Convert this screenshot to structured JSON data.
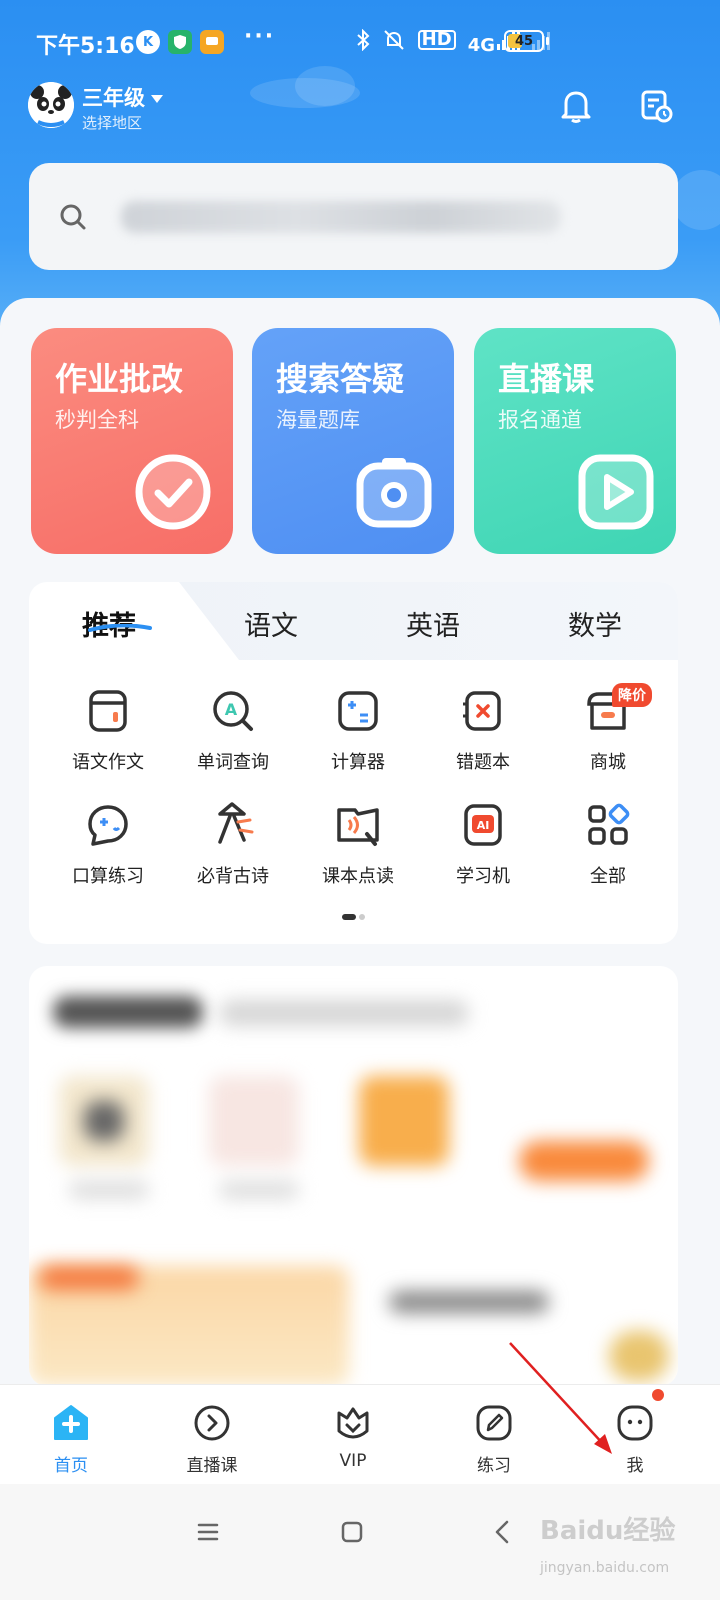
{
  "status_bar": {
    "time": "下午5:16",
    "app_icons": [
      "K",
      "shield",
      "message"
    ],
    "dots": "···",
    "hd": "HD",
    "network": "4G",
    "battery_level": "45"
  },
  "header": {
    "grade": "三年级",
    "region": "选择地区",
    "bell_icon": "bell-icon",
    "schedule_icon": "schedule-icon"
  },
  "search": {
    "icon": "search-icon"
  },
  "features": [
    {
      "title": "作业批改",
      "subtitle": "秒判全科",
      "color": "#fa7b73",
      "icon": "check-icon"
    },
    {
      "title": "搜索答疑",
      "subtitle": "海量题库",
      "color": "#5b97f5",
      "icon": "camera-icon"
    },
    {
      "title": "直播课",
      "subtitle": "报名通道",
      "color": "#4fdcbd",
      "icon": "play-icon"
    }
  ],
  "tabs": [
    "推荐",
    "语文",
    "英语",
    "数学"
  ],
  "tools": [
    {
      "label": "语文作文",
      "icon": "notebook-icon"
    },
    {
      "label": "单词查询",
      "icon": "word-search-icon"
    },
    {
      "label": "计算器",
      "icon": "calculator-icon"
    },
    {
      "label": "错题本",
      "icon": "mistake-book-icon"
    },
    {
      "label": "商城",
      "icon": "shop-icon"
    },
    {
      "label": "口算练习",
      "icon": "oral-math-icon"
    },
    {
      "label": "必背古诗",
      "icon": "poem-icon"
    },
    {
      "label": "课本点读",
      "icon": "textbook-read-icon"
    },
    {
      "label": "学习机",
      "icon": "ai-device-icon"
    },
    {
      "label": "全部",
      "icon": "all-apps-icon"
    }
  ],
  "promo_badge": "降价",
  "bottom_nav": [
    {
      "label": "首页",
      "icon": "home-icon",
      "active": true
    },
    {
      "label": "直播课",
      "icon": "live-icon",
      "active": false
    },
    {
      "label": "VIP",
      "icon": "vip-icon",
      "active": false
    },
    {
      "label": "练习",
      "icon": "practice-icon",
      "active": false
    },
    {
      "label": "我",
      "icon": "profile-icon",
      "active": false
    }
  ],
  "colors": {
    "accent": "#2b8ff2",
    "badge": "#f04a2f",
    "arrow": "#e02020"
  },
  "watermark": {
    "logo": "Baidu经验",
    "url": "jingyan.baidu.com"
  }
}
